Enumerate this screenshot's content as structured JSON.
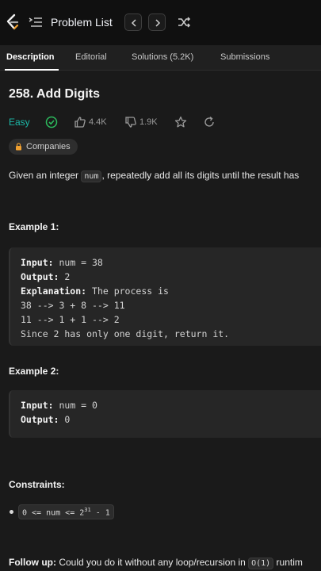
{
  "topbar": {
    "problem_list_label": "Problem List",
    "icons": [
      "logo-icon",
      "list-icon",
      "chevron-left-icon",
      "chevron-right-icon",
      "shuffle-icon"
    ]
  },
  "tabs": [
    {
      "label": "Description",
      "active": true
    },
    {
      "label": "Editorial",
      "active": false
    },
    {
      "label": "Solutions (5.2K)",
      "active": false
    },
    {
      "label": "Submissions",
      "active": false
    }
  ],
  "problem": {
    "title": "258. Add Digits",
    "difficulty": "Easy",
    "difficulty_color": "#1cb8a8",
    "likes": "4.4K",
    "dislikes": "1.9K",
    "companies_label": "Companies",
    "description_before": "Given an integer ",
    "description_code": "num",
    "description_after": ", repeatedly add all its digits until the result has"
  },
  "examples": [
    {
      "heading": "Example 1:",
      "input_label": "Input:",
      "input_value": " num = 38",
      "output_label": "Output:",
      "output_value": " 2",
      "explanation_label": "Explanation:",
      "explanation_value": " The process is",
      "extra_lines": [
        "38 --> 3 + 8 --> 11",
        "11 --> 1 + 1 --> 2",
        "Since 2 has only one digit, return it."
      ]
    },
    {
      "heading": "Example 2:",
      "input_label": "Input:",
      "input_value": " num = 0",
      "output_label": "Output:",
      "output_value": " 0"
    }
  ],
  "constraints": {
    "heading": "Constraints:",
    "item_prefix": "0 <= num <= 2",
    "item_exponent": "31",
    "item_suffix": " - 1"
  },
  "followup": {
    "label": "Follow up:",
    "text": " Could you do it without any loop/recursion in ",
    "code": "O(1)",
    "text_after": " runtim"
  }
}
